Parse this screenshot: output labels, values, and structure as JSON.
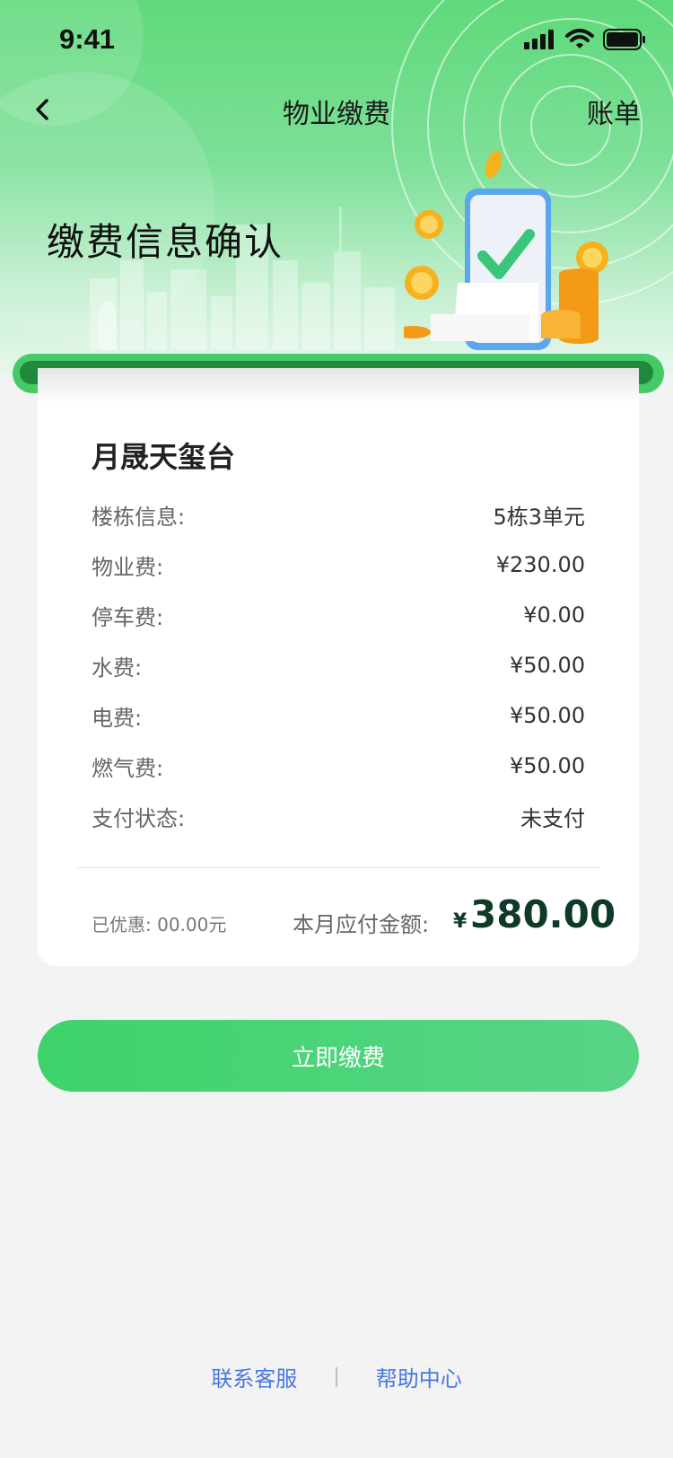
{
  "status_bar": {
    "time": "9:41"
  },
  "nav": {
    "title": "物业缴费",
    "right": "账单"
  },
  "hero": {
    "title": "缴费信息确认"
  },
  "colors": {
    "accent": "#3ed36a",
    "amount": "#0f3a25",
    "link": "#4a77e0"
  },
  "card": {
    "estate": "月晟天玺台",
    "rows": [
      {
        "label": "楼栋信息:",
        "value": "5栋3单元"
      },
      {
        "label": "物业费:",
        "value": "¥230.00"
      },
      {
        "label": "停车费:",
        "value": "¥0.00"
      },
      {
        "label": "水费:",
        "value": "¥50.00"
      },
      {
        "label": "电费:",
        "value": "¥50.00"
      },
      {
        "label": "燃气费:",
        "value": "¥50.00"
      },
      {
        "label": "支付状态:",
        "value": "未支付"
      }
    ],
    "discount": "已优惠: 00.00元",
    "due_label": "本月应付金额:",
    "due_symbol": "¥",
    "due_amount": "380.00"
  },
  "button": {
    "pay": "立即缴费"
  },
  "footer": {
    "contact": "联系客服",
    "separator": "|",
    "help": "帮助中心"
  },
  "icons": [
    "chevron-left-icon",
    "signal-icon",
    "wifi-icon",
    "battery-icon",
    "check-icon",
    "coin-icon"
  ]
}
